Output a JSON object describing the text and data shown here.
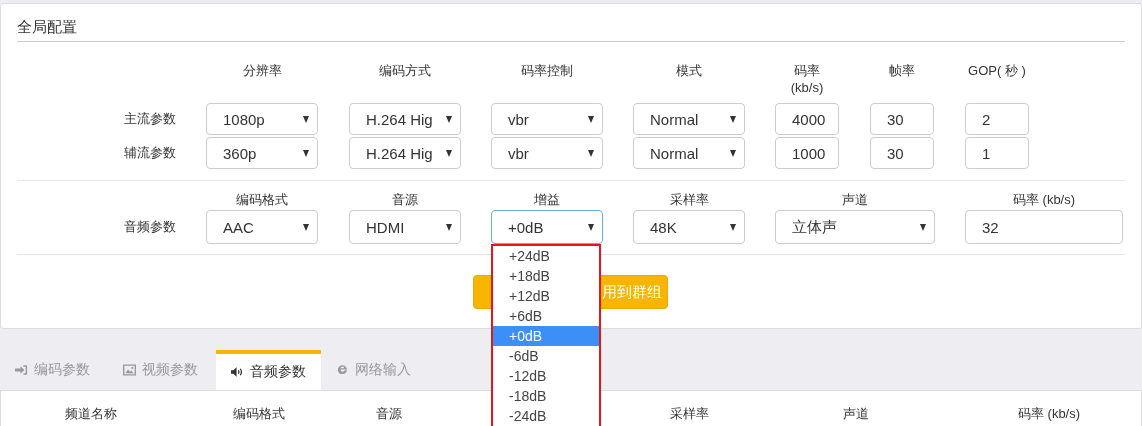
{
  "panel": {
    "title": "全局配置"
  },
  "video": {
    "headers": [
      [
        "分辨率"
      ],
      [
        "编码方式"
      ],
      [
        "码率控制"
      ],
      [
        "模式"
      ],
      [
        "码率",
        "(kb/s)"
      ],
      [
        "帧率"
      ],
      [
        "GOP( 秒 )"
      ]
    ],
    "rows": [
      {
        "label": "主流参数",
        "fields": [
          {
            "kind": "select",
            "value": "1080p"
          },
          {
            "kind": "select",
            "value": "H.264 Hig"
          },
          {
            "kind": "select",
            "value": "vbr"
          },
          {
            "kind": "select",
            "value": "Normal"
          },
          {
            "kind": "input",
            "value": "4000"
          },
          {
            "kind": "input",
            "value": "30"
          },
          {
            "kind": "input",
            "value": "2"
          }
        ]
      },
      {
        "label": "辅流参数",
        "fields": [
          {
            "kind": "select",
            "value": "360p"
          },
          {
            "kind": "select",
            "value": "H.264 Hig"
          },
          {
            "kind": "select",
            "value": "vbr"
          },
          {
            "kind": "select",
            "value": "Normal"
          },
          {
            "kind": "input",
            "value": "1000"
          },
          {
            "kind": "input",
            "value": "30"
          },
          {
            "kind": "input",
            "value": "1"
          }
        ]
      }
    ]
  },
  "audio": {
    "label": "音频参数",
    "fields": [
      {
        "header": "编码格式",
        "kind": "select",
        "value": "AAC",
        "open": false
      },
      {
        "header": "音源",
        "kind": "select",
        "value": "HDMI",
        "open": false
      },
      {
        "header": "增益",
        "kind": "select",
        "value": "+0dB",
        "open": true,
        "options": [
          {
            "label": "+24dB",
            "selected": false
          },
          {
            "label": "+18dB",
            "selected": false
          },
          {
            "label": "+12dB",
            "selected": false
          },
          {
            "label": "+6dB",
            "selected": false
          },
          {
            "label": "+0dB",
            "selected": true
          },
          {
            "label": "-6dB",
            "selected": false
          },
          {
            "label": "-12dB",
            "selected": false
          },
          {
            "label": "-18dB",
            "selected": false
          },
          {
            "label": "-24dB",
            "selected": false
          }
        ]
      },
      {
        "header": "采样率",
        "kind": "select",
        "value": "48K",
        "open": false
      },
      {
        "header": "声道",
        "kind": "select",
        "value": "立体声",
        "open": false
      },
      {
        "header": "码率 (kb/s)",
        "kind": "input",
        "value": "32",
        "open": false
      }
    ]
  },
  "apply_button": {
    "label": "用到群组"
  },
  "tabs": [
    {
      "label": "编码参数",
      "selected": false
    },
    {
      "label": "视频参数",
      "selected": false
    },
    {
      "label": "音频参数",
      "selected": true
    },
    {
      "label": "网络输入",
      "selected": false
    }
  ],
  "table": {
    "columns": [
      "频道名称",
      "编码格式",
      "音源",
      "采样率",
      "声道",
      "码率 (kb/s)"
    ]
  }
}
